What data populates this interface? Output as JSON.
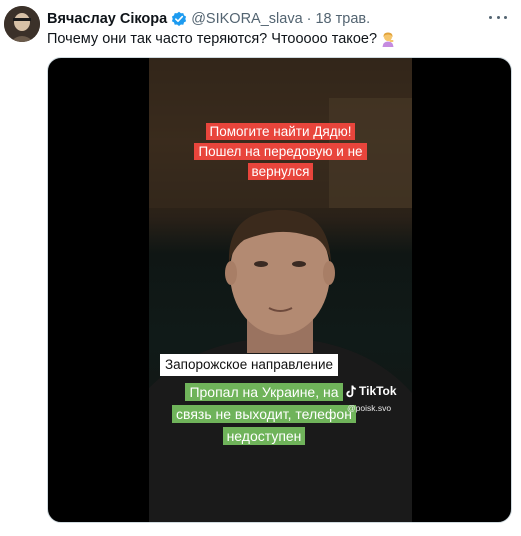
{
  "tweet": {
    "display_name": "Вячаслау Сікора",
    "handle": "@SIKORA_slava",
    "separator": "·",
    "date": "18 трав.",
    "text": "Почему они так часто теряются? Чтооооо такое?",
    "text_emoji": "person-gesturing-emoji"
  },
  "video": {
    "caption_red": "Помогите найти Дядю! Пошел на передовую и не вернулся",
    "caption_white": "Запорожское направление",
    "caption_green": "Пропал на Украине, на связь не выходит, телефон недоступен",
    "watermark_brand": "TikTok",
    "watermark_handle": "@poisk.svo"
  },
  "colors": {
    "verified": "#1d9bf0",
    "caption_red_bg": "#e8453c",
    "caption_green_bg": "#6fb35a"
  }
}
